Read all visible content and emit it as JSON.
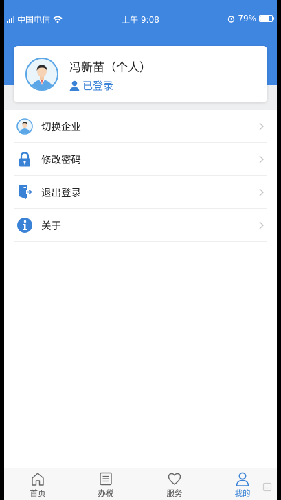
{
  "status_bar": {
    "carrier": "中国电信",
    "time": "上午 9:08",
    "battery_percent": "79%",
    "battery_level": 0.79
  },
  "profile": {
    "name": "冯新苗（个人）",
    "status": "已登录"
  },
  "menu": [
    {
      "label": "切换企业",
      "icon": "avatar-icon"
    },
    {
      "label": "修改密码",
      "icon": "lock-icon"
    },
    {
      "label": "退出登录",
      "icon": "logout-door-icon"
    },
    {
      "label": "关于",
      "icon": "info-icon"
    }
  ],
  "tabs": [
    {
      "label": "首页",
      "icon": "home-icon",
      "active": false
    },
    {
      "label": "办税",
      "icon": "list-icon",
      "active": false
    },
    {
      "label": "服务",
      "icon": "heart-icon",
      "active": false
    },
    {
      "label": "我的",
      "icon": "user-icon",
      "active": true
    }
  ],
  "colors": {
    "brand_blue": "#3f86e0",
    "accent_text": "#3a82d6",
    "background_grey": "#eeeff1"
  }
}
